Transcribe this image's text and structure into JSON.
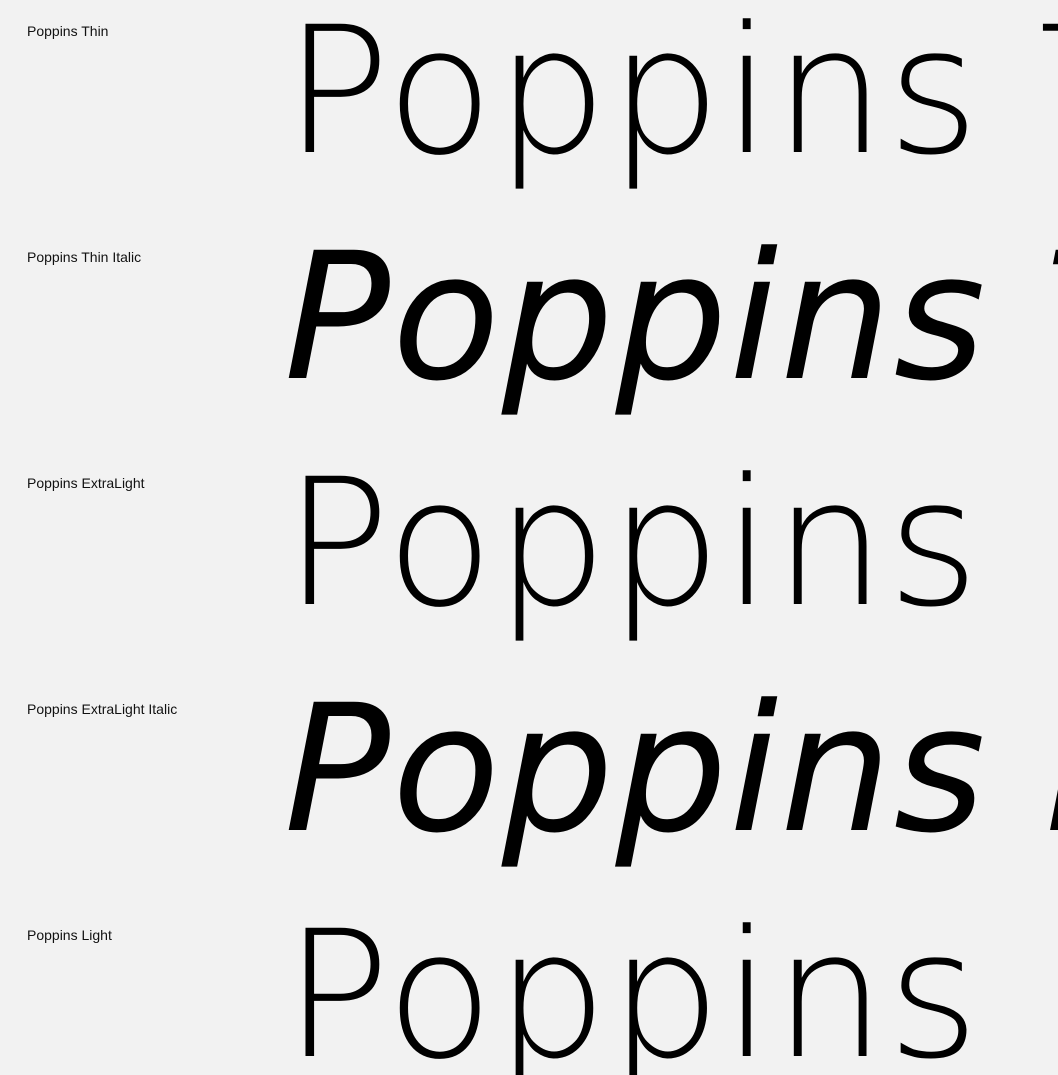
{
  "colors": {
    "background": "#f2f2f2",
    "text": "#000000"
  },
  "specimens": [
    {
      "label": "Poppins Thin",
      "sample": "Poppins Thin"
    },
    {
      "label": "Poppins Thin Italic",
      "sample": "Poppins Thin Italic"
    },
    {
      "label": "Poppins ExtraLight",
      "sample": "Poppins ExtraLight"
    },
    {
      "label": "Poppins ExtraLight Italic",
      "sample": "Poppins ExtraLight Italic"
    },
    {
      "label": "Poppins Light",
      "sample": "Poppins Light"
    }
  ]
}
